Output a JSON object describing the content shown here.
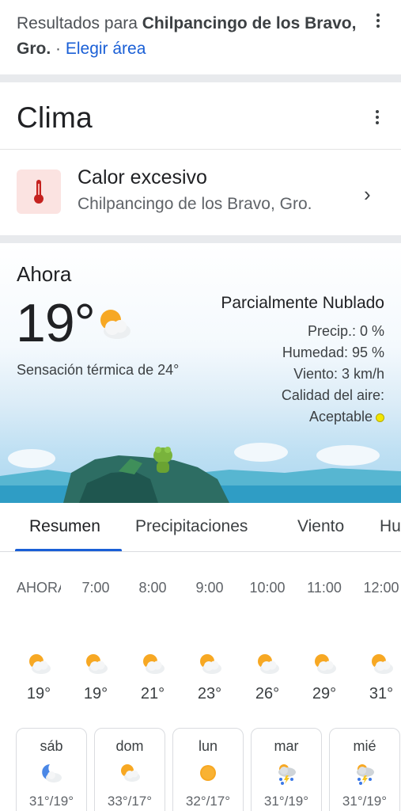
{
  "results": {
    "prefix": "Resultados para ",
    "location": "Chilpancingo de los Bravo, Gro.",
    "separator": " · ",
    "change_area": "Elegir área"
  },
  "weather": {
    "title": "Clima",
    "alert": {
      "title": "Calor excesivo",
      "location": "Chilpancingo de los Bravo, Gro.",
      "icon": "thermometer-icon"
    },
    "now": {
      "label": "Ahora",
      "temp": "19°",
      "feels_like": "Sensación térmica de 24°",
      "condition": "Parcialmente Nublado",
      "precip": "Precip.: 0 %",
      "humidity": "Humedad: 95 %",
      "wind": "Viento: 3 km/h",
      "air_quality_label": "Calidad del aire:",
      "air_quality_value": "Aceptable",
      "air_quality_color": "#f2e600"
    },
    "tabs": [
      "Resumen",
      "Precipitaciones",
      "Viento",
      "Hu"
    ],
    "hourly": [
      {
        "time": "AHORA",
        "temp": "19°",
        "icon": "partly-cloudy-icon"
      },
      {
        "time": "7:00",
        "temp": "19°",
        "icon": "partly-cloudy-icon"
      },
      {
        "time": "8:00",
        "temp": "21°",
        "icon": "partly-cloudy-icon"
      },
      {
        "time": "9:00",
        "temp": "23°",
        "icon": "partly-cloudy-icon"
      },
      {
        "time": "10:00",
        "temp": "26°",
        "icon": "partly-cloudy-icon"
      },
      {
        "time": "11:00",
        "temp": "29°",
        "icon": "partly-cloudy-icon"
      },
      {
        "time": "12:00",
        "temp": "31°",
        "icon": "partly-cloudy-icon"
      }
    ],
    "daily": [
      {
        "day": "sáb",
        "temps": "31°/19°",
        "icon": "partly-cloudy-night-icon"
      },
      {
        "day": "dom",
        "temps": "33°/17°",
        "icon": "partly-cloudy-icon"
      },
      {
        "day": "lun",
        "temps": "32°/17°",
        "icon": "sunny-icon"
      },
      {
        "day": "mar",
        "temps": "31°/19°",
        "icon": "thunderstorm-icon"
      },
      {
        "day": "mié",
        "temps": "31°/19°",
        "icon": "thunderstorm-icon"
      }
    ],
    "colors": {
      "accent": "#1a5fd6",
      "alert_bg": "#fbe3e1",
      "alert_icon": "#c5221f"
    }
  }
}
